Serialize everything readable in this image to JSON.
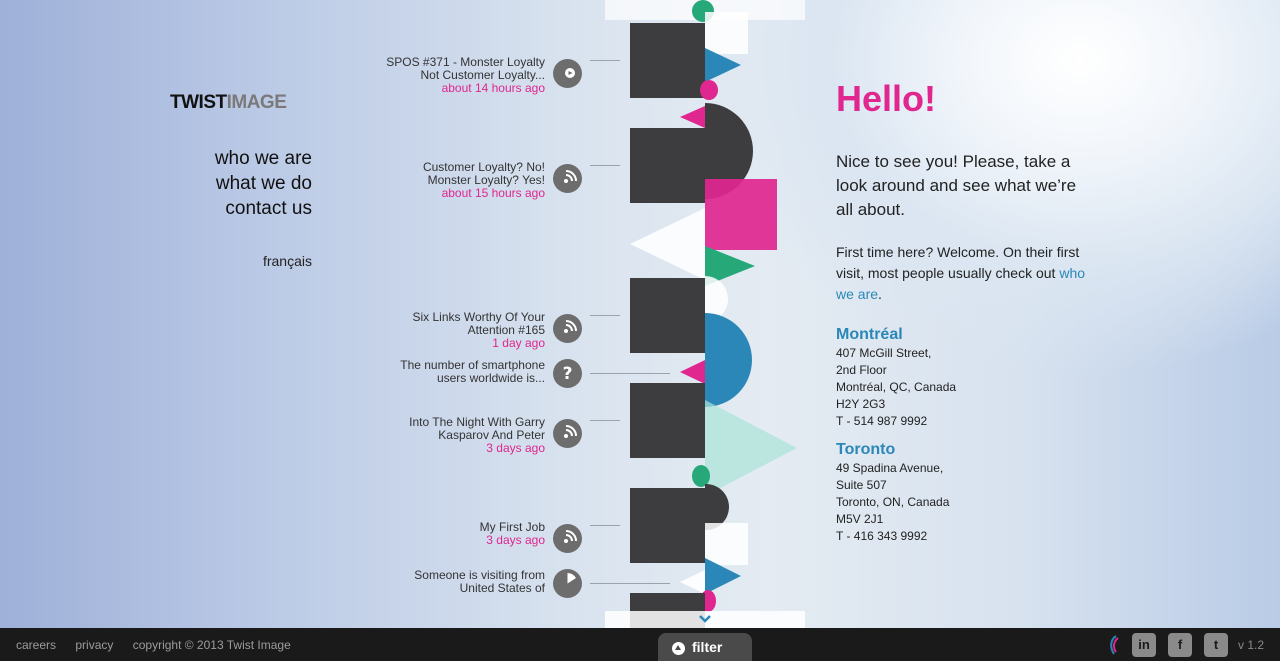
{
  "brand": {
    "part1": "TWIST",
    "part2": "IMAGE"
  },
  "nav": {
    "who": "who we are",
    "what": "what we do",
    "contact": "contact us",
    "lang": "français"
  },
  "feed": [
    {
      "l1": "SPOS #371 - Monster Loyalty",
      "l2": "Not Customer Loyalty...",
      "time": "about 14 hours ago",
      "icon": "play-icon"
    },
    {
      "l1": "Customer Loyalty? No!",
      "l2": "Monster Loyalty? Yes!",
      "time": "about 15 hours ago",
      "icon": "rss-icon"
    },
    {
      "l1": "Six Links Worthy Of Your",
      "l2": "Attention #165",
      "time": "1 day ago",
      "icon": "rss-icon"
    },
    {
      "l1": "The number of smartphone",
      "l2": "users worldwide is...",
      "time": "",
      "icon": "question-icon"
    },
    {
      "l1": "Into The Night With Garry",
      "l2": "Kasparov And Peter",
      "time": "3 days ago",
      "icon": "rss-icon"
    },
    {
      "l1": "My First Job",
      "l2": "",
      "time": "3 days ago",
      "icon": "rss-icon"
    },
    {
      "l1": "Someone is visiting from",
      "l2": "United States of",
      "time": "",
      "icon": "pie-icon"
    }
  ],
  "right": {
    "hello": "Hello!",
    "lead": "Nice to see you! Please, take a look around and see what we’re all about.",
    "intro": "First time here? Welcome. On their first visit, most people usually check out",
    "intro_link": "who we are",
    "intro_end": "."
  },
  "offices": [
    {
      "city": "Montréal",
      "lines": [
        "407 McGill Street,",
        "2nd Floor",
        "Montréal, QC, Canada",
        "H2Y 2G3",
        "T - 514 987 9992"
      ]
    },
    {
      "city": "Toronto",
      "lines": [
        "49 Spadina Avenue,",
        "Suite 507",
        "Toronto, ON, Canada",
        "M5V 2J1",
        "T - 416 343 9992"
      ]
    }
  ],
  "footer": {
    "careers": "careers",
    "privacy": "privacy",
    "copyright": "copyright © 2013 Twist Image",
    "filter": "filter",
    "version": "v 1.2",
    "social": [
      "in",
      "f",
      "t"
    ]
  },
  "colors": {
    "pink": "#e0268f",
    "blue": "#2b87b8",
    "green": "#27a878",
    "dark": "#3d3c3f"
  }
}
